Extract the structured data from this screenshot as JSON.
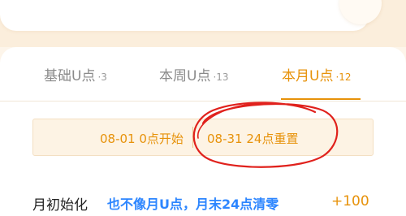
{
  "tabs": [
    {
      "label": "基础U点",
      "count": "·3",
      "active": false
    },
    {
      "label": "本周U点",
      "count": "·13",
      "active": false
    },
    {
      "label": "本月U点",
      "count": "·12",
      "active": true
    }
  ],
  "period": {
    "start": "08-01 0点开始",
    "end": "08-31 24点重置"
  },
  "task_row": {
    "label": "月初始化",
    "note": "也不像月U点，月末24点清零",
    "points": "+100"
  },
  "colors": {
    "accent": "#e7920a",
    "annotation_red": "#e0211c",
    "note_blue": "#2d86ff"
  }
}
